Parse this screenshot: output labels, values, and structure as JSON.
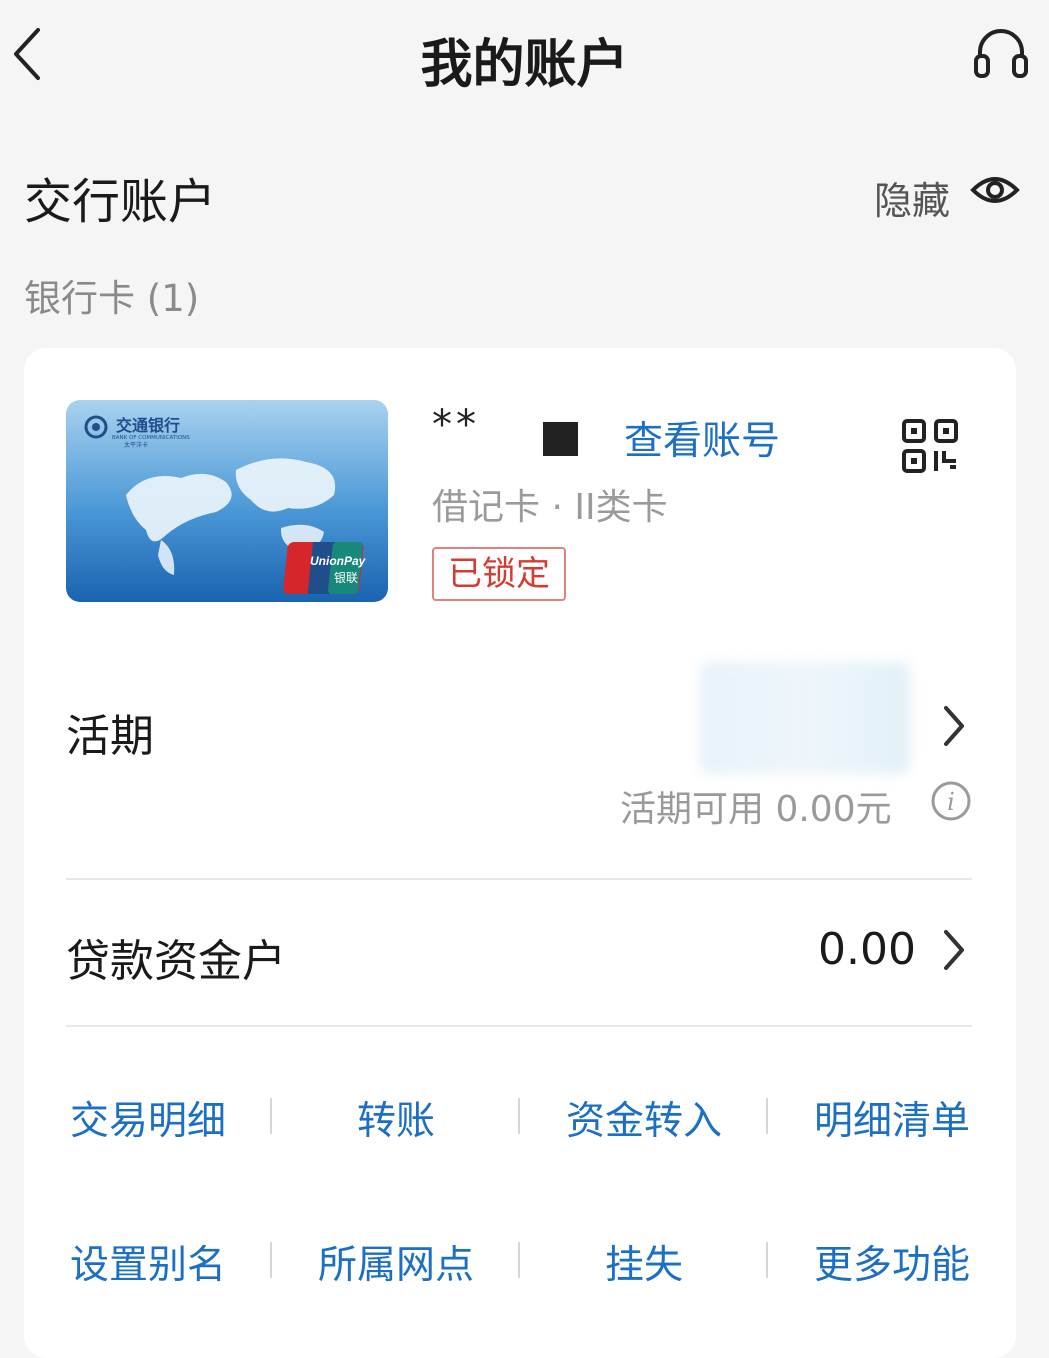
{
  "header": {
    "title": "我的账户",
    "back_icon": "chevron-left-icon",
    "service_icon": "headset-icon"
  },
  "section": {
    "title": "交行账户",
    "hide_label": "隐藏",
    "eye_icon": "eye-icon",
    "card_count_label": "银行卡 (1)"
  },
  "card": {
    "number_masked": "**",
    "view_number_label": "查看账号",
    "card_type": "借记卡 · II类卡",
    "status_badge": "已锁定",
    "qr_icon": "qr-code-icon",
    "card_image": {
      "bank_name": "交通银行",
      "bank_name_en": "BANK OF COMMUNICATIONS",
      "card_series": "太平洋卡",
      "network_logo": "UnionPay",
      "network_logo_cn": "银联"
    }
  },
  "current_account": {
    "label": "活期",
    "available_label": "活期可用 0.00元",
    "info_icon": "info-icon"
  },
  "loan_account": {
    "label": "贷款资金户",
    "value": "0.00"
  },
  "actions_row1": [
    "交易明细",
    "转账",
    "资金转入",
    "明细清单"
  ],
  "actions_row2": [
    "设置别名",
    "所属网点",
    "挂失",
    "更多功能"
  ],
  "colors": {
    "accent_blue": "#1b6fc4",
    "locked_red": "#d63a30",
    "background": "#f5f5f5"
  }
}
